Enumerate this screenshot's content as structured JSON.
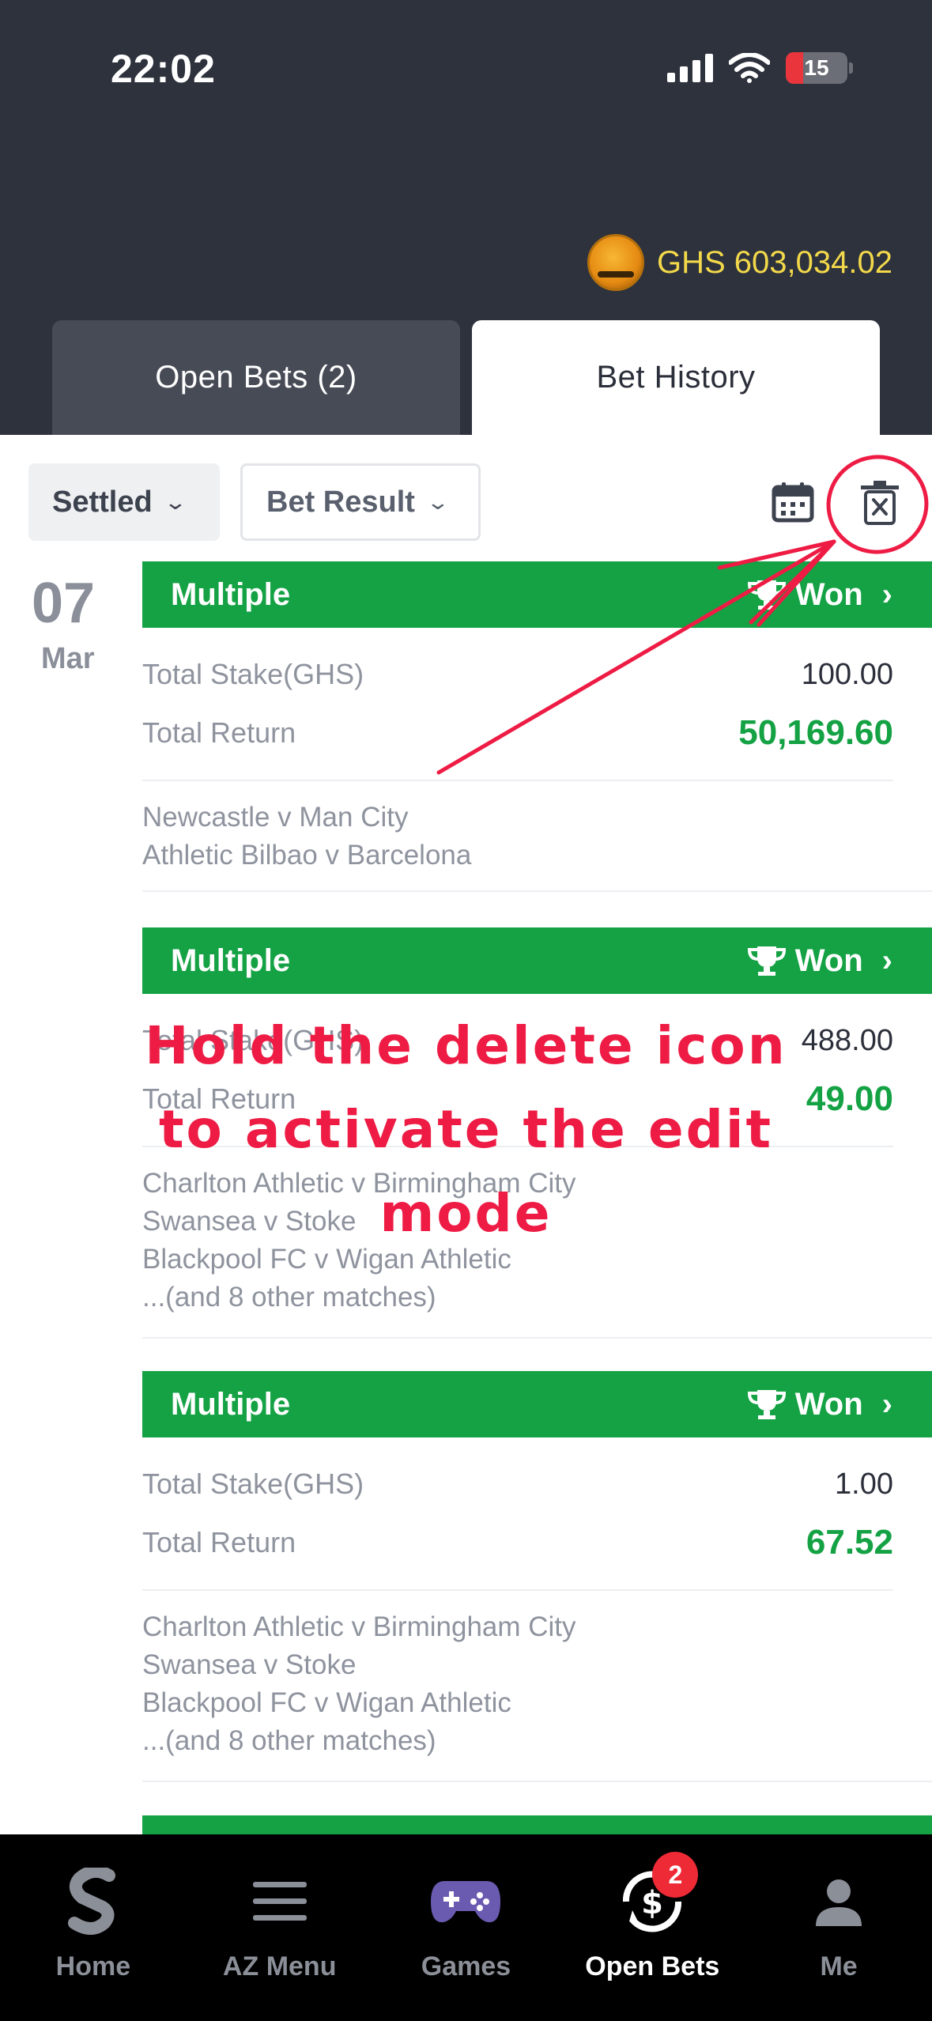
{
  "status": {
    "time": "22:02",
    "battery": "15"
  },
  "header": {
    "balance": "GHS 603,034.02"
  },
  "tabs": {
    "open": "Open Bets (2)",
    "history": "Bet History"
  },
  "filters": {
    "settled": "Settled",
    "result": "Bet Result"
  },
  "date": {
    "day": "07",
    "month": "Mar"
  },
  "labels": {
    "stake": "Total Stake(GHS)",
    "return": "Total Return"
  },
  "bets": [
    {
      "type": "Multiple",
      "status": "Won",
      "stake": "100.00",
      "return": "50,169.60",
      "matches": [
        "Newcastle v Man City",
        "Athletic Bilbao v Barcelona"
      ]
    },
    {
      "type": "Multiple",
      "status": "Won",
      "stake": "488.00",
      "return": "49.00",
      "matches": [
        "Charlton Athletic v Birmingham City",
        "Swansea v Stoke",
        "Blackpool FC v Wigan Athletic",
        "...(and 8 other matches)"
      ]
    },
    {
      "type": "Multiple",
      "status": "Won",
      "stake": "1.00",
      "return": "67.52",
      "matches": [
        "Charlton Athletic v Birmingham City",
        "Swansea v Stoke",
        "Blackpool FC v Wigan Athletic",
        "...(and 8 other matches)"
      ]
    }
  ],
  "annotation": {
    "line1": "Hold the delete icon",
    "line2": "to activate the edit",
    "line3": "mode"
  },
  "nav": {
    "home": "Home",
    "menu": "AZ Menu",
    "games": "Games",
    "open_bets": "Open Bets",
    "me": "Me",
    "badge": "2"
  },
  "colors": {
    "header": "#2e323d",
    "green": "#14a244",
    "annotation": "#ee1c44",
    "balance": "#f3d94a"
  }
}
